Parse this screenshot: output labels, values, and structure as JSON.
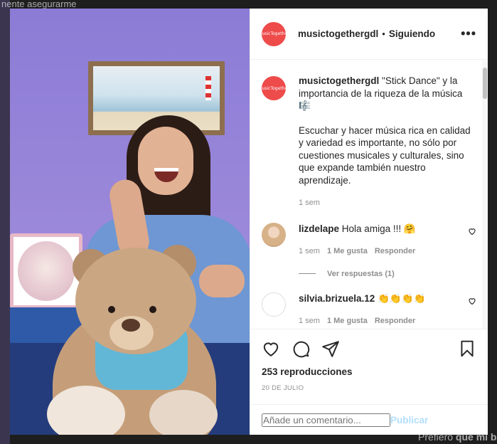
{
  "background": {
    "text_top": "nente asegurarme",
    "text_bottom_prefix": "Prefiero",
    "text_bottom_bold": "que mi b"
  },
  "post": {
    "username": "musictogethergdl",
    "follow_status": "Siguiendo",
    "separator": "•",
    "more_label": "•••",
    "avatar_text": "MusicTogether"
  },
  "caption": {
    "username": "musictogethergdl",
    "title": "\"Stick Dance\" y la importancia de la riqueza de la música 🎼",
    "body": "Escuchar y hacer música rica en calidad y variedad es importante, no sólo por cuestiones musicales y culturales, sino que expande también nuestro aprendizaje.",
    "time": "1 sem"
  },
  "comments": [
    {
      "username": "lizdelape",
      "text": "Hola amiga !!! 🤗",
      "time": "1 sem",
      "likes": "1 Me gusta",
      "reply": "Responder",
      "view_replies": "Ver respuestas (1)"
    },
    {
      "username": "silvia.brizuela.12",
      "text": "👏👏👏👏",
      "time": "1 sem",
      "likes": "1 Me gusta",
      "reply": "Responder"
    }
  ],
  "actions": {
    "views": "253 reproducciones",
    "date": "20 DE JULIO"
  },
  "composer": {
    "placeholder": "Añade un comentario...",
    "publish_label": "Publicar"
  },
  "colors": {
    "avatar_brand": "#ee4b4b",
    "text": "#262626",
    "muted": "#8e8e8e",
    "publish_disabled": "#b2dffc"
  }
}
